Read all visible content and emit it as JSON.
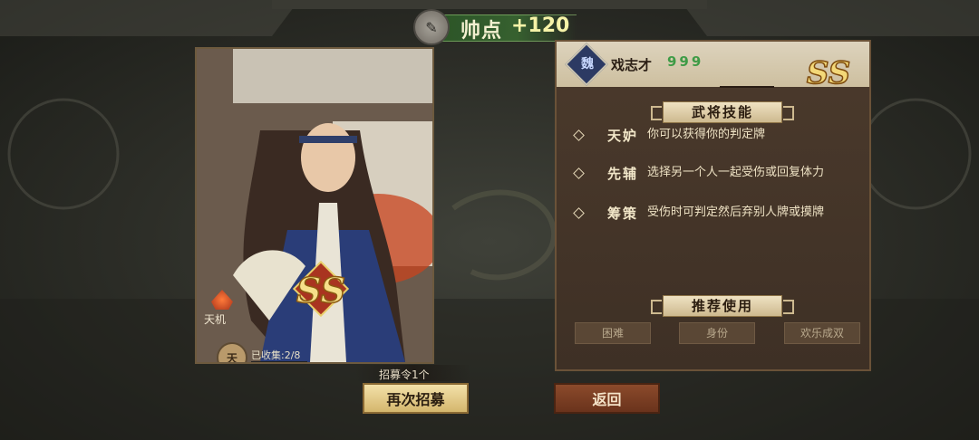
{
  "banner": {
    "label": "帅点",
    "value": "+120"
  },
  "card": {
    "kind": "天机",
    "seal": "天",
    "collect_label": "已收集:2/8",
    "collect_progress": 0.25,
    "rank": "SS"
  },
  "hero": {
    "name": "戏志才",
    "stars": "999",
    "rank": "SS"
  },
  "skills_title": "武将技能",
  "skills": [
    {
      "name": "天妒",
      "desc": "你可以获得你的判定牌"
    },
    {
      "name": "先辅",
      "desc": "选择另一个人一起受伤或回复体力"
    },
    {
      "name": "筹策",
      "desc": "受伤时可判定然后弃别人牌或摸牌"
    }
  ],
  "recommend_title": "推荐使用",
  "tags": [
    "困难",
    "身份",
    "欢乐成双"
  ],
  "recruit_count": "招募令1个",
  "buttons": {
    "recruit": "再次招募",
    "back": "返回"
  },
  "colors": {
    "stars": "#3e9b46",
    "banner_value": "#f6f3a8",
    "back_button": "#7a3d22",
    "recruit_button": "#e4cc8a"
  }
}
